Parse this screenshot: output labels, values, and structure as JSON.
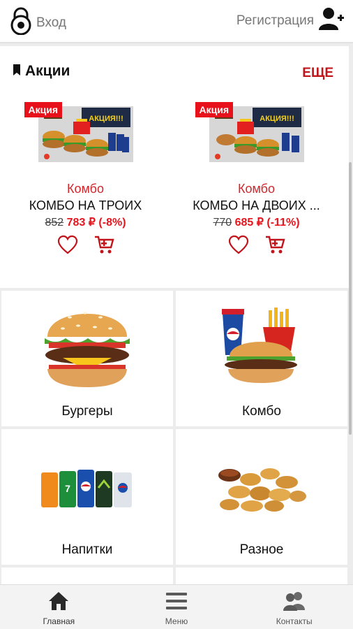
{
  "header": {
    "login_label": "Вход",
    "register_label": "Регистрация"
  },
  "promotions": {
    "title": "Акции",
    "more_label": "ЕЩЕ",
    "items": [
      {
        "badge": "Акция",
        "category": "Комбо",
        "name": "КОМБО НА ТРОИХ",
        "old_price": "852",
        "new_price": "783 ₽ (-8%)"
      },
      {
        "badge": "Акция",
        "category": "Комбо",
        "name": "КОМБО НА ДВОИХ ...",
        "old_price": "770",
        "new_price": "685 ₽ (-11%)"
      }
    ]
  },
  "categories": [
    {
      "label": "Бургеры",
      "icon": "burger-image"
    },
    {
      "label": "Комбо",
      "icon": "combo-image"
    },
    {
      "label": "Напитки",
      "icon": "drinks-image"
    },
    {
      "label": "Разное",
      "icon": "nuggets-image"
    }
  ],
  "bottom_nav": [
    {
      "label": "Главная",
      "icon": "home-icon",
      "active": true
    },
    {
      "label": "Меню",
      "icon": "menu-icon",
      "active": false
    },
    {
      "label": "Контакты",
      "icon": "contacts-icon",
      "active": false
    }
  ],
  "colors": {
    "accent": "#c0151b",
    "price": "#e4161d",
    "badge": "#e8101a",
    "background": "#ececec"
  }
}
